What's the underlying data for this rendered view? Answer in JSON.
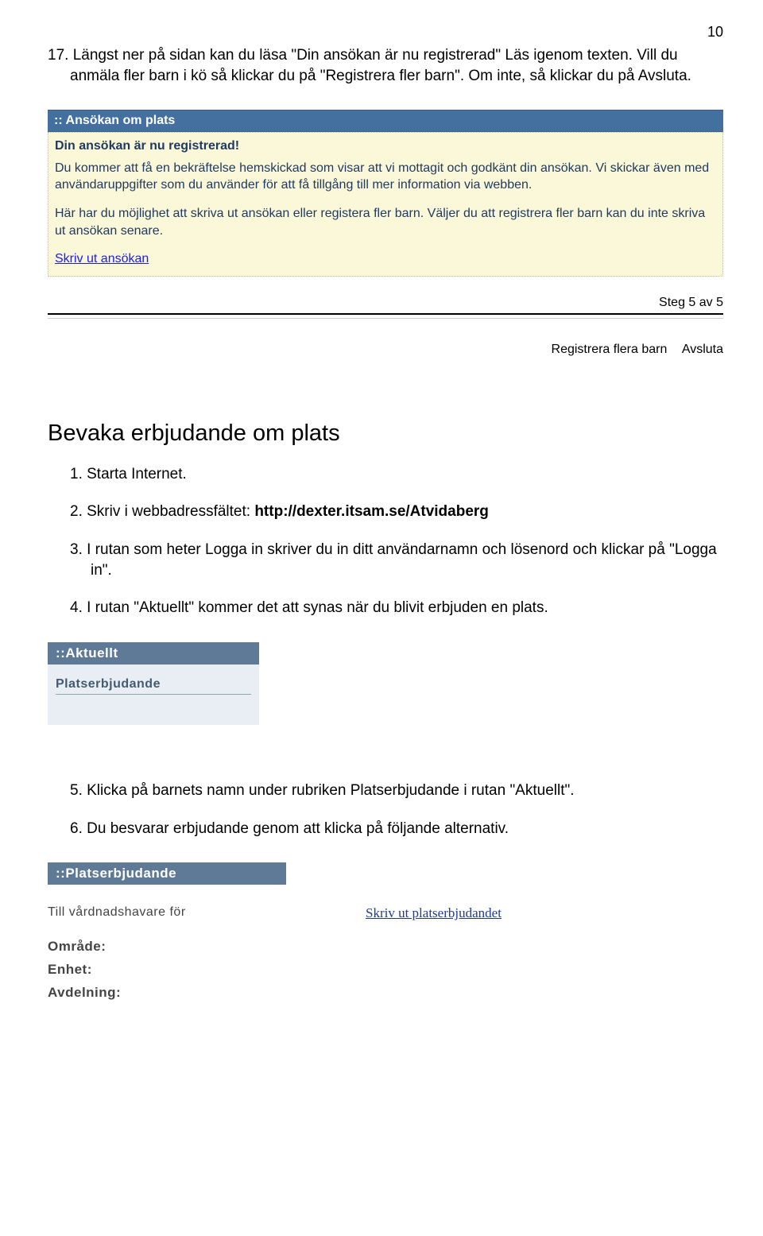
{
  "page_number": "10",
  "intro_text": "17. Längst ner på sidan kan du läsa \"Din ansökan är nu registrerad\" Läs igenom texten. Vill du anmäla fler barn i kö så klickar du på \"Registrera fler barn\". Om inte, så klickar du på Avsluta.",
  "ansokan": {
    "header": ":: Ansökan om plats",
    "title": "Din ansökan är nu registrerad!",
    "p1": "Du kommer att få en bekräftelse hemskickad som visar att vi mottagit och godkänt din ansökan. Vi skickar även med användaruppgifter som du använder för att få tillgång till mer information via webben.",
    "p2": "Här har du möjlighet att skriva ut ansökan eller registera fler barn. Väljer du att registrera fler barn kan du inte skriva ut ansökan senare.",
    "link": "Skriv ut ansökan"
  },
  "step_indicator": "Steg 5 av 5",
  "actions": {
    "register_more": "Registrera flera barn",
    "finish": "Avsluta"
  },
  "bevaka": {
    "heading": "Bevaka erbjudande om plats",
    "items": {
      "i1": "1. Starta Internet.",
      "i2_pre": "2. Skriv i webbadressfältet: ",
      "i2_bold": "http://dexter.itsam.se/Atvidaberg",
      "i3": "3. I rutan som heter Logga in skriver du in ditt användarnamn och lösenord och klickar på \"Logga in\".",
      "i4": "4. I rutan \"Aktuellt\" kommer det att synas när du blivit erbjuden en plats."
    }
  },
  "aktuellt": {
    "header": "::Aktuellt",
    "subhead": "Platserbjudande"
  },
  "followup": {
    "i5": "5. Klicka på barnets namn under rubriken Platserbjudande i rutan \"Aktuellt\".",
    "i6": "6. Du besvarar erbjudande genom att klicka på följande alternativ."
  },
  "plats": {
    "header": "::Platserbjudande",
    "left": "Till vårdnadshavare för",
    "right": "Skriv ut platserbjudandet",
    "fields": {
      "f1": "Område:",
      "f2": "Enhet:",
      "f3": "Avdelning:"
    }
  }
}
